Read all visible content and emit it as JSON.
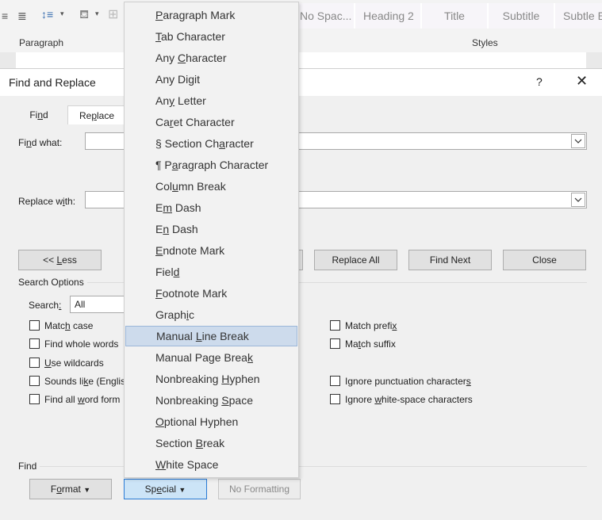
{
  "ribbon": {
    "paragraph_group": "Paragraph",
    "styles_group": "Styles",
    "style_tiles": [
      "No Spac...",
      "Heading 2",
      "Title",
      "Subtitle",
      "Subtle Em"
    ]
  },
  "dialog": {
    "title": "Find and Replace",
    "help": "?",
    "close": "✕",
    "tabs": {
      "find": "Find",
      "replace": "Replace"
    },
    "find_what_label": "Find what:",
    "replace_with_label": "Replace with:",
    "buttons": {
      "less": "<< Less",
      "replace_all": "Replace All",
      "find_next": "Find Next",
      "close": "Close",
      "format": "Format",
      "special": "Special",
      "no_formatting": "No Formatting"
    },
    "search_options_label": "Search Options",
    "search_label": "Search:",
    "search_value": "All",
    "options_left": [
      "Match case",
      "Find whole words",
      "Use wildcards",
      "Sounds like (Englis",
      "Find all word form"
    ],
    "options_right": [
      "Match prefix",
      "Match suffix",
      "Ignore punctuation characters",
      "Ignore white-space characters"
    ],
    "find_section_label": "Find"
  },
  "special_menu": {
    "items": [
      "Paragraph Mark",
      "Tab Character",
      "Any Character",
      "Any Digit",
      "Any Letter",
      "Caret Character",
      "§ Section Character",
      "¶ Paragraph Character",
      "Column Break",
      "Em Dash",
      "En Dash",
      "Endnote Mark",
      "Field",
      "Footnote Mark",
      "Graphic",
      "Manual Line Break",
      "Manual Page Break",
      "Nonbreaking Hyphen",
      "Nonbreaking Space",
      "Optional Hyphen",
      "Section Break",
      "White Space"
    ],
    "highlighted": "Manual Line Break"
  },
  "colors": {
    "highlight": "#cddbec",
    "pressed": "#cce4f7",
    "accent": "#2a7ad4"
  }
}
